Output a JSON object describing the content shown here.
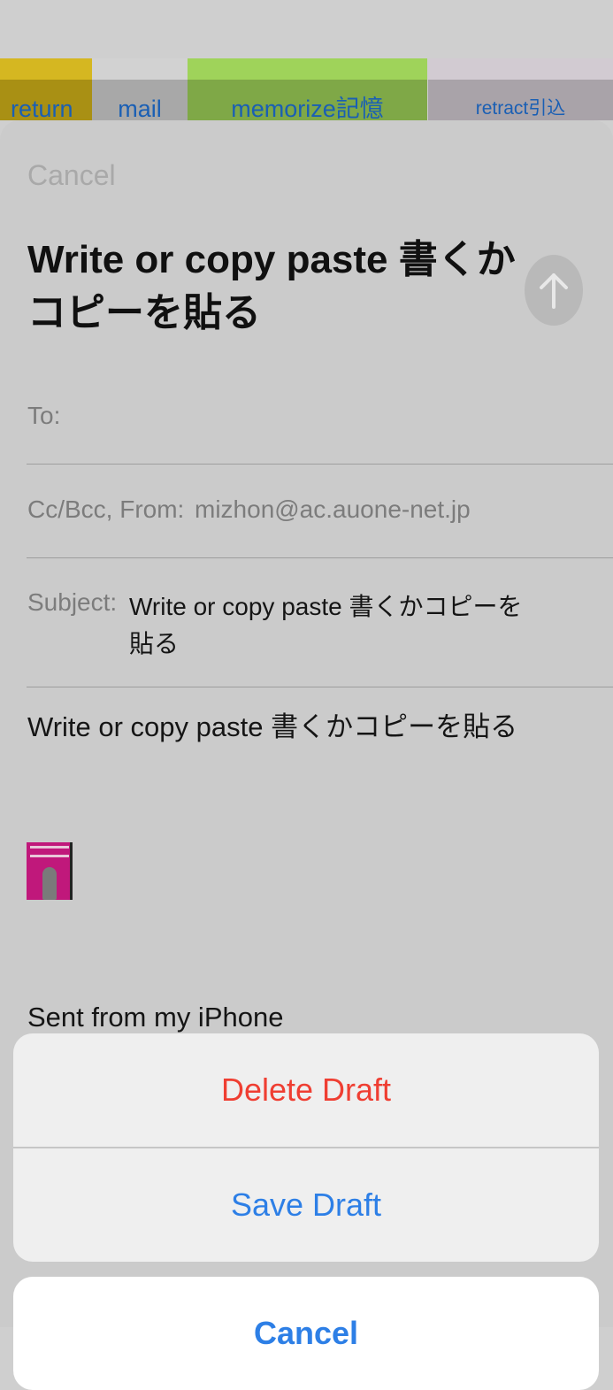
{
  "background_tabs": [
    {
      "label": "return"
    },
    {
      "label": "mail"
    },
    {
      "label": "memorize記憶"
    },
    {
      "label": "retract引込"
    }
  ],
  "compose": {
    "cancel_label": "Cancel",
    "title": "Write or copy paste  書くかコピーを貼る",
    "send_icon": "arrow-up-icon",
    "to_label": "To:",
    "ccbcc_label": "Cc/Bcc, From:",
    "from_value": "mizhon@ac.auone-net.jp",
    "subject_label": "Subject:",
    "subject_value": "Write or copy paste  書くかコピーを貼る",
    "body_text": "Write or copy paste 書くかコピーを貼る",
    "attachment_icon": "image-thumbnail-icon",
    "signature": "Sent from my iPhone"
  },
  "action_sheet": {
    "delete_label": "Delete Draft",
    "save_label": "Save Draft",
    "cancel_label": "Cancel"
  },
  "colors": {
    "destructive": "#ef3e32",
    "accent": "#2d7fe6"
  }
}
